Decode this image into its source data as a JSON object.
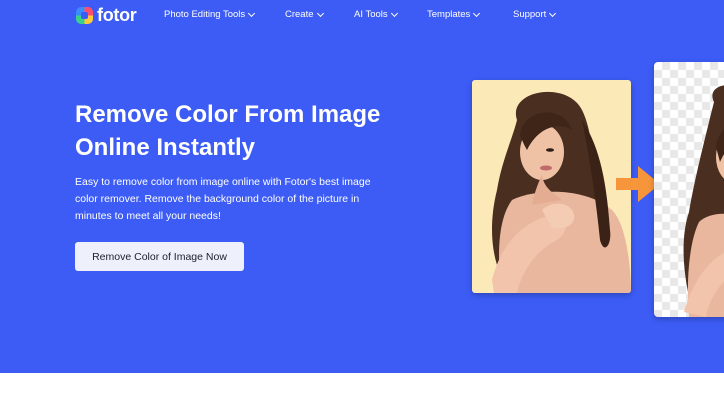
{
  "nav": {
    "logo_text": "fotor",
    "items": [
      {
        "label": "Photo Editing Tools"
      },
      {
        "label": "Create"
      },
      {
        "label": "AI Tools"
      },
      {
        "label": "Templates"
      },
      {
        "label": "Support"
      }
    ]
  },
  "hero": {
    "title_line1": "Remove Color From Image",
    "title_line2": "Online Instantly",
    "description": "Easy to remove color from image online with Fotor's best image color remover. Remove the background color of the picture in minutes to meet all your needs!",
    "cta_label": "Remove Color of Image Now"
  },
  "colors": {
    "hero_bg": "#3c5cf5",
    "cta_bg": "#eef0fb",
    "arrow": "#f7953a",
    "photo_bg": "#fbe9b8"
  },
  "icons": {
    "logo": "fotor-logo-icon",
    "chevron": "chevron-down-icon",
    "arrow": "arrow-right-icon"
  }
}
